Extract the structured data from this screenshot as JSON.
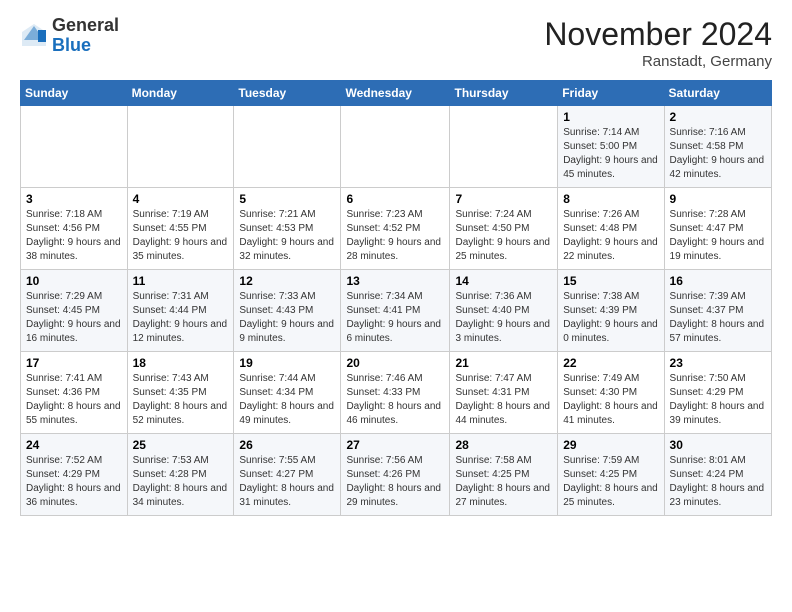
{
  "logo": {
    "general": "General",
    "blue": "Blue"
  },
  "header": {
    "month": "November 2024",
    "location": "Ranstadt, Germany"
  },
  "weekdays": [
    "Sunday",
    "Monday",
    "Tuesday",
    "Wednesday",
    "Thursday",
    "Friday",
    "Saturday"
  ],
  "weeks": [
    [
      {
        "day": "",
        "info": ""
      },
      {
        "day": "",
        "info": ""
      },
      {
        "day": "",
        "info": ""
      },
      {
        "day": "",
        "info": ""
      },
      {
        "day": "",
        "info": ""
      },
      {
        "day": "1",
        "info": "Sunrise: 7:14 AM\nSunset: 5:00 PM\nDaylight: 9 hours and 45 minutes."
      },
      {
        "day": "2",
        "info": "Sunrise: 7:16 AM\nSunset: 4:58 PM\nDaylight: 9 hours and 42 minutes."
      }
    ],
    [
      {
        "day": "3",
        "info": "Sunrise: 7:18 AM\nSunset: 4:56 PM\nDaylight: 9 hours and 38 minutes."
      },
      {
        "day": "4",
        "info": "Sunrise: 7:19 AM\nSunset: 4:55 PM\nDaylight: 9 hours and 35 minutes."
      },
      {
        "day": "5",
        "info": "Sunrise: 7:21 AM\nSunset: 4:53 PM\nDaylight: 9 hours and 32 minutes."
      },
      {
        "day": "6",
        "info": "Sunrise: 7:23 AM\nSunset: 4:52 PM\nDaylight: 9 hours and 28 minutes."
      },
      {
        "day": "7",
        "info": "Sunrise: 7:24 AM\nSunset: 4:50 PM\nDaylight: 9 hours and 25 minutes."
      },
      {
        "day": "8",
        "info": "Sunrise: 7:26 AM\nSunset: 4:48 PM\nDaylight: 9 hours and 22 minutes."
      },
      {
        "day": "9",
        "info": "Sunrise: 7:28 AM\nSunset: 4:47 PM\nDaylight: 9 hours and 19 minutes."
      }
    ],
    [
      {
        "day": "10",
        "info": "Sunrise: 7:29 AM\nSunset: 4:45 PM\nDaylight: 9 hours and 16 minutes."
      },
      {
        "day": "11",
        "info": "Sunrise: 7:31 AM\nSunset: 4:44 PM\nDaylight: 9 hours and 12 minutes."
      },
      {
        "day": "12",
        "info": "Sunrise: 7:33 AM\nSunset: 4:43 PM\nDaylight: 9 hours and 9 minutes."
      },
      {
        "day": "13",
        "info": "Sunrise: 7:34 AM\nSunset: 4:41 PM\nDaylight: 9 hours and 6 minutes."
      },
      {
        "day": "14",
        "info": "Sunrise: 7:36 AM\nSunset: 4:40 PM\nDaylight: 9 hours and 3 minutes."
      },
      {
        "day": "15",
        "info": "Sunrise: 7:38 AM\nSunset: 4:39 PM\nDaylight: 9 hours and 0 minutes."
      },
      {
        "day": "16",
        "info": "Sunrise: 7:39 AM\nSunset: 4:37 PM\nDaylight: 8 hours and 57 minutes."
      }
    ],
    [
      {
        "day": "17",
        "info": "Sunrise: 7:41 AM\nSunset: 4:36 PM\nDaylight: 8 hours and 55 minutes."
      },
      {
        "day": "18",
        "info": "Sunrise: 7:43 AM\nSunset: 4:35 PM\nDaylight: 8 hours and 52 minutes."
      },
      {
        "day": "19",
        "info": "Sunrise: 7:44 AM\nSunset: 4:34 PM\nDaylight: 8 hours and 49 minutes."
      },
      {
        "day": "20",
        "info": "Sunrise: 7:46 AM\nSunset: 4:33 PM\nDaylight: 8 hours and 46 minutes."
      },
      {
        "day": "21",
        "info": "Sunrise: 7:47 AM\nSunset: 4:31 PM\nDaylight: 8 hours and 44 minutes."
      },
      {
        "day": "22",
        "info": "Sunrise: 7:49 AM\nSunset: 4:30 PM\nDaylight: 8 hours and 41 minutes."
      },
      {
        "day": "23",
        "info": "Sunrise: 7:50 AM\nSunset: 4:29 PM\nDaylight: 8 hours and 39 minutes."
      }
    ],
    [
      {
        "day": "24",
        "info": "Sunrise: 7:52 AM\nSunset: 4:29 PM\nDaylight: 8 hours and 36 minutes."
      },
      {
        "day": "25",
        "info": "Sunrise: 7:53 AM\nSunset: 4:28 PM\nDaylight: 8 hours and 34 minutes."
      },
      {
        "day": "26",
        "info": "Sunrise: 7:55 AM\nSunset: 4:27 PM\nDaylight: 8 hours and 31 minutes."
      },
      {
        "day": "27",
        "info": "Sunrise: 7:56 AM\nSunset: 4:26 PM\nDaylight: 8 hours and 29 minutes."
      },
      {
        "day": "28",
        "info": "Sunrise: 7:58 AM\nSunset: 4:25 PM\nDaylight: 8 hours and 27 minutes."
      },
      {
        "day": "29",
        "info": "Sunrise: 7:59 AM\nSunset: 4:25 PM\nDaylight: 8 hours and 25 minutes."
      },
      {
        "day": "30",
        "info": "Sunrise: 8:01 AM\nSunset: 4:24 PM\nDaylight: 8 hours and 23 minutes."
      }
    ]
  ]
}
